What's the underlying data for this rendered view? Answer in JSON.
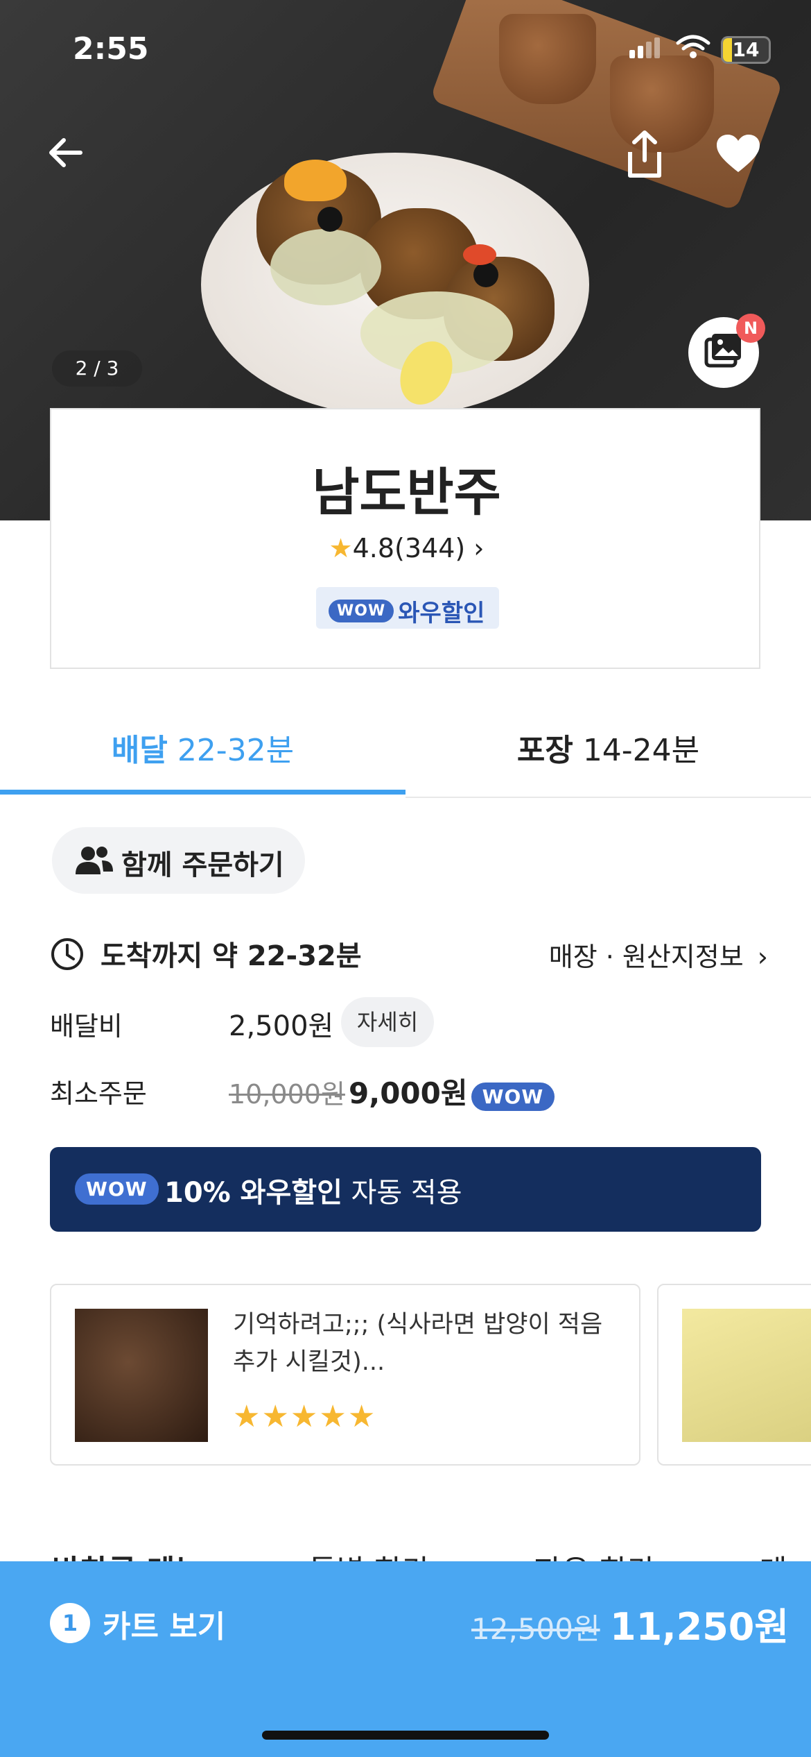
{
  "status_bar": {
    "time": "2:55",
    "battery": "14"
  },
  "hero": {
    "image_counter": "2 / 3",
    "new_badge": "N"
  },
  "store": {
    "name": "남도반주",
    "rating": "4.8",
    "review_count": "(344)",
    "wow_badge": "WOW",
    "wow_label": "와우할인"
  },
  "tabs": {
    "delivery": {
      "label": "배달",
      "time": "22-32분"
    },
    "pickup": {
      "label": "포장",
      "time": "14-24분"
    }
  },
  "group_order": {
    "label": "함께 주문하기"
  },
  "delivery_info": {
    "arrive_label": "도착까지 약 22-32분",
    "store_info_link": "매장 · 원산지정보",
    "fee_label": "배달비",
    "fee_value": "2,500원",
    "detail_label": "자세히",
    "min_order_label": "최소주문",
    "min_order_old": "10,000원",
    "min_order_new": "9,000원",
    "wow_badge": "WOW"
  },
  "wow_banner": {
    "badge": "WOW",
    "highlight": "10% 와우할인",
    "rest": "자동 적용"
  },
  "reviews": [
    {
      "text": "기억하려고;;; (식사라면 밥양이 적음 추가 시킬것)...",
      "stars": 5
    }
  ],
  "menu_tabs": [
    "반찬류 메뉴",
    "특별 한라",
    "자유 한라",
    "계드"
  ],
  "cart": {
    "count": "1",
    "label": "카트 보기",
    "old_price": "12,500원",
    "new_price": "11,250원"
  },
  "colors": {
    "accent": "#3ea0f0",
    "wow_blue": "#3b68c4",
    "banner": "#142e5e",
    "cart_bar": "#4aa7f2"
  }
}
